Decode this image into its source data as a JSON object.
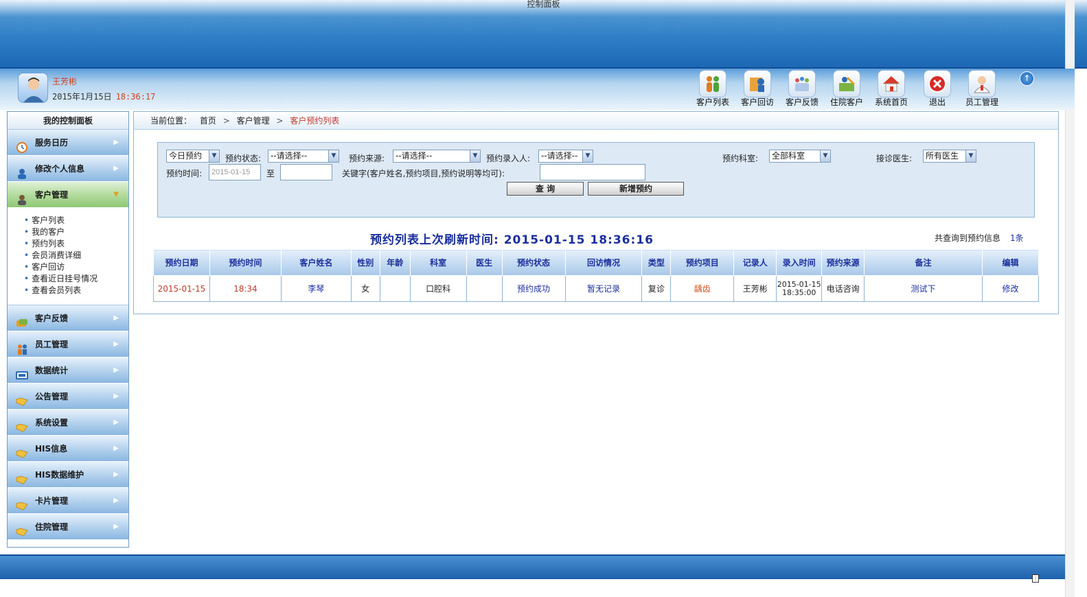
{
  "window_title": "控制面板",
  "user": {
    "name": "王芳彬",
    "date": "2015年1月15日",
    "time": "18:36:17"
  },
  "top_nav": [
    {
      "label": "客户列表",
      "icon": "customers-icon"
    },
    {
      "label": "客户回访",
      "icon": "return-visit-icon"
    },
    {
      "label": "客户反馈",
      "icon": "feedback-icon"
    },
    {
      "label": "住院客户",
      "icon": "inpatient-icon"
    },
    {
      "label": "系统首页",
      "icon": "home-icon"
    },
    {
      "label": "退出",
      "icon": "exit-icon"
    },
    {
      "label": "员工管理",
      "icon": "staff-icon"
    }
  ],
  "sidebar": {
    "title": "我的控制面板",
    "menus_top": [
      {
        "label": "服务日历",
        "icon": "clock-icon"
      },
      {
        "label": "修改个人信息",
        "icon": "user-edit-icon"
      },
      {
        "label": "客户管理",
        "icon": "customer-icon"
      }
    ],
    "submenu": [
      "客户列表",
      "我的客户",
      "预约列表",
      "会员消费详细",
      "客户回访",
      "查看近日挂号情况",
      "查看会员列表"
    ],
    "menus_bottom": [
      {
        "label": "客户反馈",
        "icon": "feedback-icon"
      },
      {
        "label": "员工管理",
        "icon": "staff-icon"
      },
      {
        "label": "数据统计",
        "icon": "stats-icon"
      },
      {
        "label": "公告管理",
        "icon": "folder-icon"
      },
      {
        "label": "系统设置",
        "icon": "folder-icon"
      },
      {
        "label": "HIS信息",
        "icon": "folder-icon"
      },
      {
        "label": "HIS数据维护",
        "icon": "folder-icon"
      },
      {
        "label": "卡片管理",
        "icon": "folder-icon"
      },
      {
        "label": "住院管理",
        "icon": "folder-icon"
      }
    ]
  },
  "breadcrumb": {
    "prefix": "当前位置：",
    "home": "首页",
    "section": "客户管理",
    "current": "客户预约列表"
  },
  "filter": {
    "range_select": "今日预约",
    "status_label": "预约状态:",
    "status_value": "--请选择--",
    "source_label": "预约来源:",
    "source_value": "--请选择--",
    "recorder_label": "预约录入人:",
    "recorder_value": "--请选择--",
    "dept_label": "预约科室:",
    "dept_value": "全部科室",
    "doctor_label": "接诊医生:",
    "doctor_value": "所有医生",
    "time_label": "预约时间:",
    "time_from": "2015-01-15",
    "to_label": "至",
    "time_to": "",
    "keyword_label": "关键字(客户姓名,预约项目,预约说明等均可):",
    "keyword_value": "",
    "query_button": "查 询",
    "add_button": "新增预约"
  },
  "list": {
    "title": "预约列表上次刷新时间: 2015-01-15 18:36:16",
    "count_prefix": "共查询到预约信息",
    "count_value": "1条"
  },
  "table": {
    "headers": [
      "预约日期",
      "预约时间",
      "客户姓名",
      "性别",
      "年龄",
      "科室",
      "医生",
      "预约状态",
      "回访情况",
      "类型",
      "预约项目",
      "记录人",
      "录入时间",
      "预约来源",
      "备注",
      "编辑"
    ],
    "rows": [
      {
        "date": "2015-01-15",
        "time": "18:34",
        "name": "李琴",
        "gender": "女",
        "age": "",
        "dept": "口腔科",
        "doctor": "",
        "status": "预约成功",
        "visit": "暂无记录",
        "type": "复诊",
        "item": "龋齿",
        "recorder": "王芳彬",
        "entry_time": "2015-01-15 18:35:00",
        "source": "电话咨询",
        "note": "测试下",
        "edit": "修改"
      }
    ]
  }
}
